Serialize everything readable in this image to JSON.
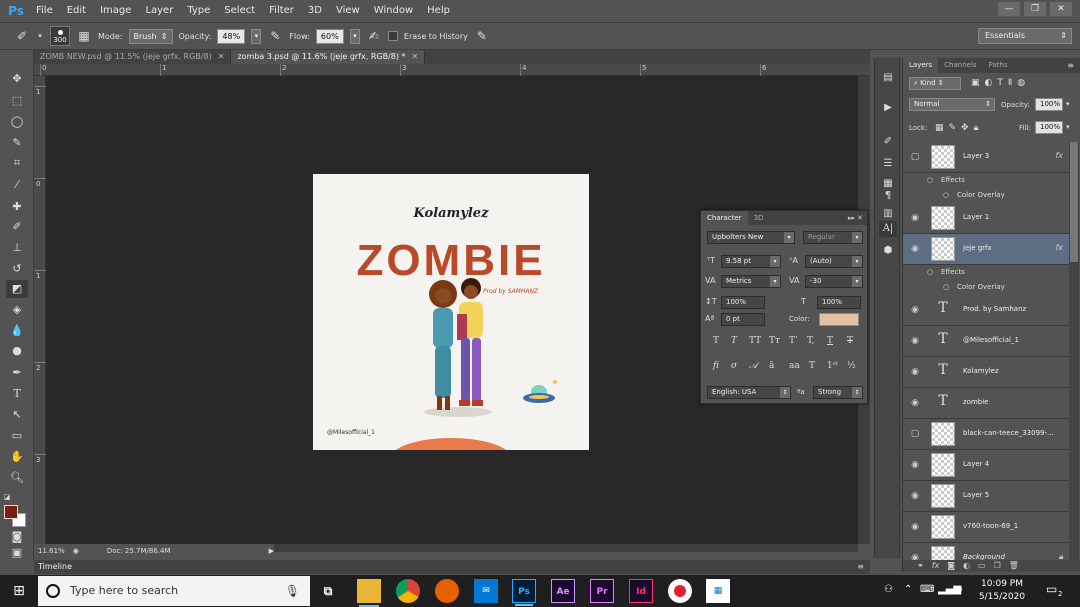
{
  "menu": [
    "File",
    "Edit",
    "Image",
    "Layer",
    "Type",
    "Select",
    "Filter",
    "3D",
    "View",
    "Window",
    "Help"
  ],
  "app_logo": "Ps",
  "options": {
    "brush_size": "300",
    "mode_label": "Mode:",
    "mode_value": "Brush",
    "opacity_label": "Opacity:",
    "opacity_value": "48%",
    "flow_label": "Flow:",
    "flow_value": "60%",
    "erase_history_label": "Erase to History",
    "workspace": "Essentials"
  },
  "tabs": [
    {
      "label": "ZOMB NEW.psd @ 11.5% (jeje grfx, RGB/8)",
      "active": false
    },
    {
      "label": "zomba 3.psd @ 11.6% (jeje grfx, RGB/8) *",
      "active": true
    }
  ],
  "ruler_h": [
    "0",
    "1",
    "2",
    "3",
    "4",
    "5",
    "6"
  ],
  "ruler_v": [
    "1",
    "0",
    "1",
    "2",
    "3"
  ],
  "artwork": {
    "brand": "Kolamylez",
    "title": "ZOMBIE",
    "prod": "Prod by SAMHANZ",
    "handle": "@Milesofficial_1"
  },
  "character": {
    "tab_active": "Character",
    "tab_other": "3D",
    "font_family": "Upbolters New",
    "font_style": "Regular",
    "font_size": "9.58 pt",
    "leading": "(Auto)",
    "kerning": "Metrics",
    "tracking": "-30",
    "vscale": "100%",
    "hscale": "100%",
    "baseline": "0 pt",
    "color_label": "Color:",
    "language": "English: USA",
    "aa_label": "a",
    "antialias": "Strong"
  },
  "layers_panel": {
    "tabs": [
      "Layers",
      "Channels",
      "Paths"
    ],
    "kind": "Kind",
    "blend": "Normal",
    "opacity_label": "Opacity:",
    "opacity": "100%",
    "lock_label": "Lock:",
    "fill_label": "Fill:",
    "fill": "100%",
    "effects_label": "Effects",
    "color_overlay_label": "Color Overlay",
    "layers": [
      {
        "name": "Layer 3",
        "type": "pixel",
        "visible": false,
        "fx": true
      },
      {
        "name": "Layer 1",
        "type": "pixel",
        "visible": true,
        "fx": false
      },
      {
        "name": "jeje grfx",
        "type": "smart",
        "visible": true,
        "fx": true,
        "selected": true
      },
      {
        "name": "Prod. by  Samhanz",
        "type": "text",
        "visible": true
      },
      {
        "name": "@Milesofficial_1",
        "type": "text",
        "visible": true
      },
      {
        "name": "Kolamylez",
        "type": "text",
        "visible": true
      },
      {
        "name": "zombie",
        "type": "text",
        "visible": true
      },
      {
        "name": "black-can-teece_33099-...",
        "type": "pixel",
        "visible": false
      },
      {
        "name": "Layer 4",
        "type": "pixel",
        "visible": true
      },
      {
        "name": "Layer 5",
        "type": "pixel",
        "visible": true
      },
      {
        "name": "v760-toon-69_1",
        "type": "pixel",
        "visible": true
      },
      {
        "name": "Background",
        "type": "pixel",
        "visible": true,
        "locked": true
      }
    ]
  },
  "status": {
    "zoom": "11.61%",
    "doc": "Doc: 25.7M/86.4M"
  },
  "timeline_label": "Timeline",
  "taskbar": {
    "search_placeholder": "Type here to search",
    "time": "10:09 PM",
    "date": "5/15/2020",
    "apps": [
      {
        "label": "Ae",
        "color": "#d291ff"
      },
      {
        "label": "Pr",
        "color": "#ea77ff"
      },
      {
        "label": "Id",
        "color": "#ff3366"
      }
    ],
    "ps_label": "Ps",
    "notif_count": "2"
  }
}
